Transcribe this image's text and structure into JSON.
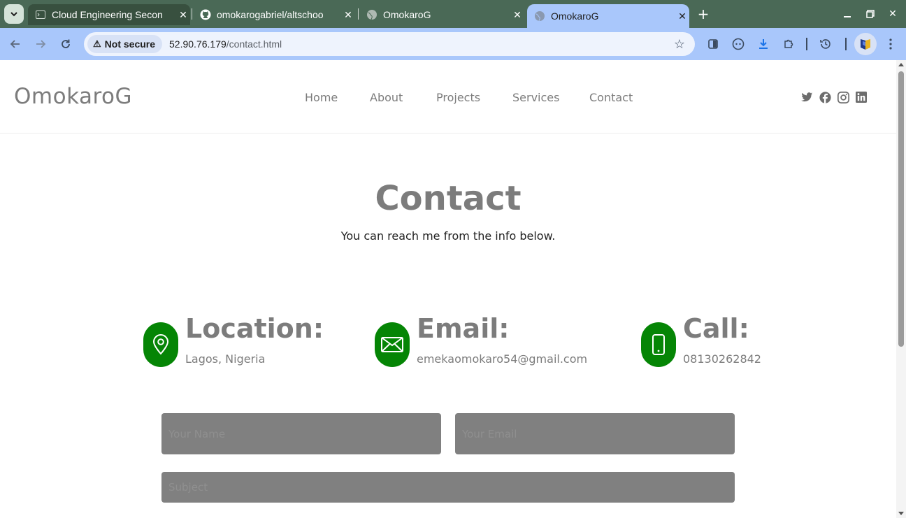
{
  "browser": {
    "tabs": [
      {
        "title": "Cloud Engineering Secon",
        "favicon": "terminal-icon"
      },
      {
        "title": "omokarogabriel/altschoo",
        "favicon": "github-icon"
      },
      {
        "title": "OmokaroG",
        "favicon": "globe-icon"
      },
      {
        "title": "OmokaroG",
        "favicon": "globe-icon",
        "active": true
      }
    ],
    "security_label": "Not secure",
    "url_host": "52.90.76.179",
    "url_path": "/contact.html"
  },
  "site": {
    "logo": "OmokaroG",
    "nav": [
      "Home",
      "About",
      "Projects",
      "Services",
      "Contact"
    ],
    "socials": [
      "twitter-icon",
      "facebook-icon",
      "instagram-icon",
      "linkedin-icon"
    ]
  },
  "contact": {
    "title": "Contact",
    "subtitle": "You can reach me from the info below.",
    "items": [
      {
        "icon": "location-pin-icon",
        "heading": "Location:",
        "value": "Lagos, Nigeria"
      },
      {
        "icon": "envelope-icon",
        "heading": "Email:",
        "value": "emekaomokaro54@gmail.com"
      },
      {
        "icon": "phone-icon",
        "heading": "Call:",
        "value": "08130262842"
      }
    ],
    "form": {
      "name_placeholder": "Your Name",
      "email_placeholder": "Your Email",
      "subject_placeholder": "Subject"
    }
  },
  "colors": {
    "accent_green": "#058505",
    "text_gray": "#7c7c7c",
    "input_gray": "#808080",
    "tabstrip": "#4a6956",
    "toolbar": "#a9c7fb"
  }
}
